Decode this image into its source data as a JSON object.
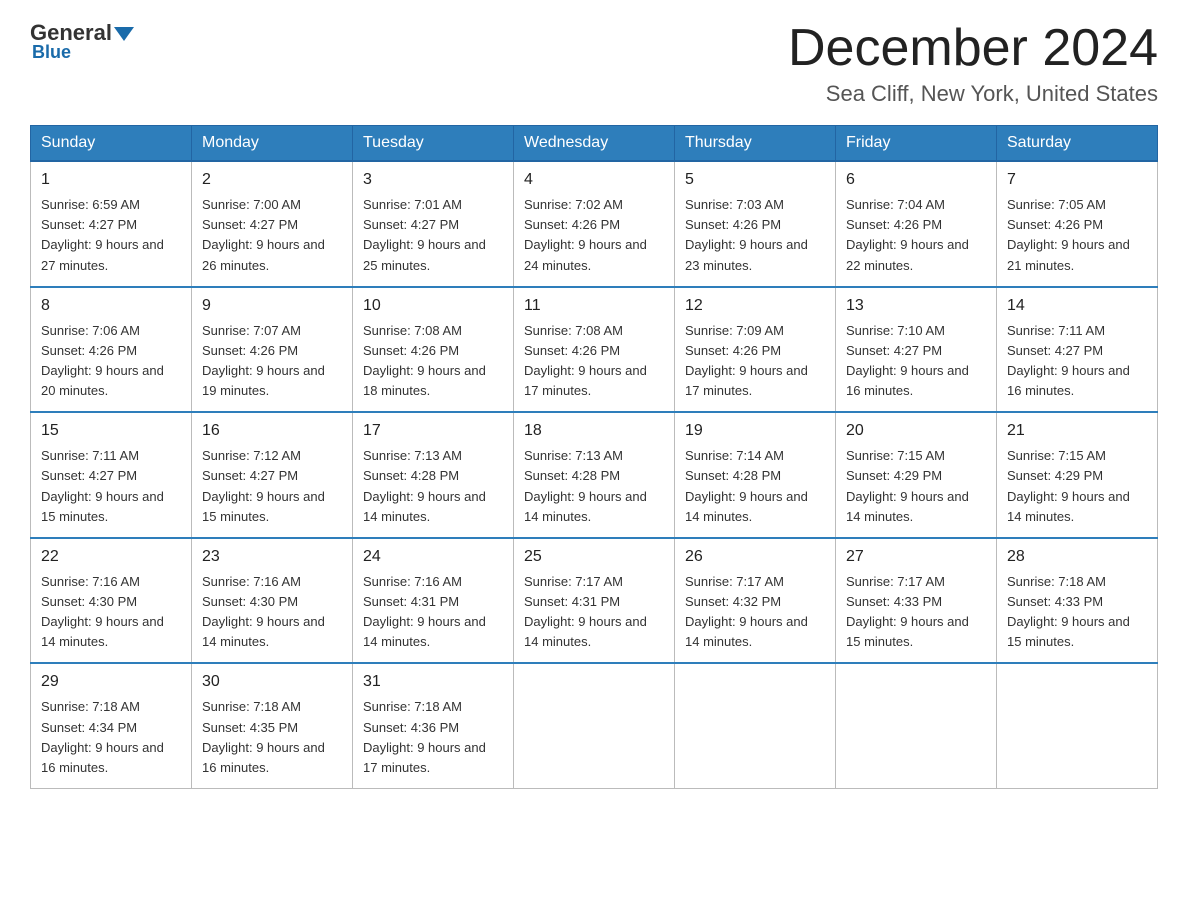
{
  "header": {
    "logo_general": "General",
    "logo_blue": "Blue",
    "month_title": "December 2024",
    "location": "Sea Cliff, New York, United States"
  },
  "days_of_week": [
    "Sunday",
    "Monday",
    "Tuesday",
    "Wednesday",
    "Thursday",
    "Friday",
    "Saturday"
  ],
  "weeks": [
    [
      {
        "day": "1",
        "sunrise": "6:59 AM",
        "sunset": "4:27 PM",
        "daylight": "9 hours and 27 minutes."
      },
      {
        "day": "2",
        "sunrise": "7:00 AM",
        "sunset": "4:27 PM",
        "daylight": "9 hours and 26 minutes."
      },
      {
        "day": "3",
        "sunrise": "7:01 AM",
        "sunset": "4:27 PM",
        "daylight": "9 hours and 25 minutes."
      },
      {
        "day": "4",
        "sunrise": "7:02 AM",
        "sunset": "4:26 PM",
        "daylight": "9 hours and 24 minutes."
      },
      {
        "day": "5",
        "sunrise": "7:03 AM",
        "sunset": "4:26 PM",
        "daylight": "9 hours and 23 minutes."
      },
      {
        "day": "6",
        "sunrise": "7:04 AM",
        "sunset": "4:26 PM",
        "daylight": "9 hours and 22 minutes."
      },
      {
        "day": "7",
        "sunrise": "7:05 AM",
        "sunset": "4:26 PM",
        "daylight": "9 hours and 21 minutes."
      }
    ],
    [
      {
        "day": "8",
        "sunrise": "7:06 AM",
        "sunset": "4:26 PM",
        "daylight": "9 hours and 20 minutes."
      },
      {
        "day": "9",
        "sunrise": "7:07 AM",
        "sunset": "4:26 PM",
        "daylight": "9 hours and 19 minutes."
      },
      {
        "day": "10",
        "sunrise": "7:08 AM",
        "sunset": "4:26 PM",
        "daylight": "9 hours and 18 minutes."
      },
      {
        "day": "11",
        "sunrise": "7:08 AM",
        "sunset": "4:26 PM",
        "daylight": "9 hours and 17 minutes."
      },
      {
        "day": "12",
        "sunrise": "7:09 AM",
        "sunset": "4:26 PM",
        "daylight": "9 hours and 17 minutes."
      },
      {
        "day": "13",
        "sunrise": "7:10 AM",
        "sunset": "4:27 PM",
        "daylight": "9 hours and 16 minutes."
      },
      {
        "day": "14",
        "sunrise": "7:11 AM",
        "sunset": "4:27 PM",
        "daylight": "9 hours and 16 minutes."
      }
    ],
    [
      {
        "day": "15",
        "sunrise": "7:11 AM",
        "sunset": "4:27 PM",
        "daylight": "9 hours and 15 minutes."
      },
      {
        "day": "16",
        "sunrise": "7:12 AM",
        "sunset": "4:27 PM",
        "daylight": "9 hours and 15 minutes."
      },
      {
        "day": "17",
        "sunrise": "7:13 AM",
        "sunset": "4:28 PM",
        "daylight": "9 hours and 14 minutes."
      },
      {
        "day": "18",
        "sunrise": "7:13 AM",
        "sunset": "4:28 PM",
        "daylight": "9 hours and 14 minutes."
      },
      {
        "day": "19",
        "sunrise": "7:14 AM",
        "sunset": "4:28 PM",
        "daylight": "9 hours and 14 minutes."
      },
      {
        "day": "20",
        "sunrise": "7:15 AM",
        "sunset": "4:29 PM",
        "daylight": "9 hours and 14 minutes."
      },
      {
        "day": "21",
        "sunrise": "7:15 AM",
        "sunset": "4:29 PM",
        "daylight": "9 hours and 14 minutes."
      }
    ],
    [
      {
        "day": "22",
        "sunrise": "7:16 AM",
        "sunset": "4:30 PM",
        "daylight": "9 hours and 14 minutes."
      },
      {
        "day": "23",
        "sunrise": "7:16 AM",
        "sunset": "4:30 PM",
        "daylight": "9 hours and 14 minutes."
      },
      {
        "day": "24",
        "sunrise": "7:16 AM",
        "sunset": "4:31 PM",
        "daylight": "9 hours and 14 minutes."
      },
      {
        "day": "25",
        "sunrise": "7:17 AM",
        "sunset": "4:31 PM",
        "daylight": "9 hours and 14 minutes."
      },
      {
        "day": "26",
        "sunrise": "7:17 AM",
        "sunset": "4:32 PM",
        "daylight": "9 hours and 14 minutes."
      },
      {
        "day": "27",
        "sunrise": "7:17 AM",
        "sunset": "4:33 PM",
        "daylight": "9 hours and 15 minutes."
      },
      {
        "day": "28",
        "sunrise": "7:18 AM",
        "sunset": "4:33 PM",
        "daylight": "9 hours and 15 minutes."
      }
    ],
    [
      {
        "day": "29",
        "sunrise": "7:18 AM",
        "sunset": "4:34 PM",
        "daylight": "9 hours and 16 minutes."
      },
      {
        "day": "30",
        "sunrise": "7:18 AM",
        "sunset": "4:35 PM",
        "daylight": "9 hours and 16 minutes."
      },
      {
        "day": "31",
        "sunrise": "7:18 AM",
        "sunset": "4:36 PM",
        "daylight": "9 hours and 17 minutes."
      },
      null,
      null,
      null,
      null
    ]
  ]
}
